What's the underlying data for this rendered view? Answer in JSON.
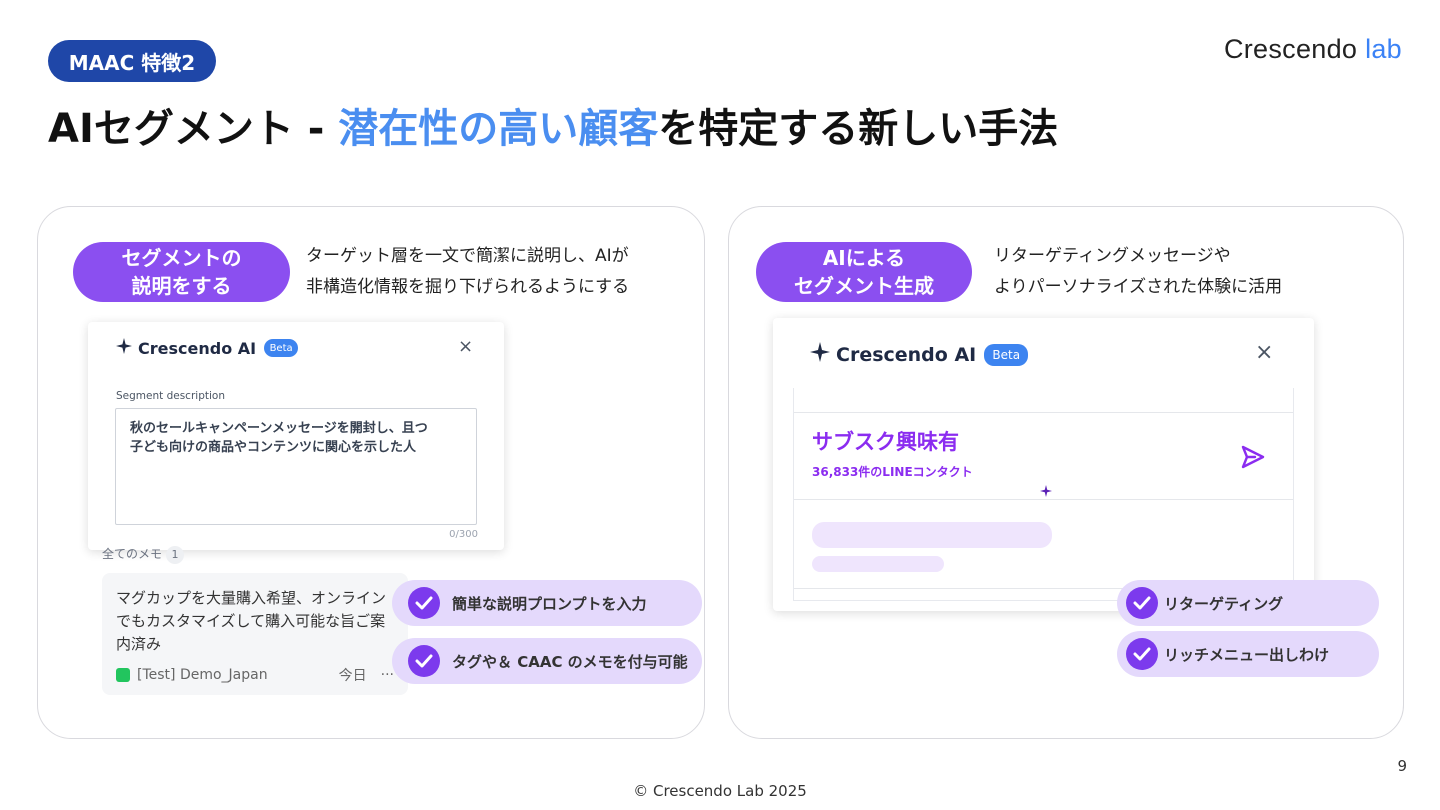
{
  "header": {
    "badge": "MAAC 特徴2",
    "logo_main": "Crescendo",
    "logo_accent": "lab",
    "title_pre": "AIセグメント - ",
    "title_highlight": "潜在性の高い顧客",
    "title_post": "を特定する新しい手法"
  },
  "left_panel": {
    "pill": "セグメントの\n説明をする",
    "description": "ターゲット層を一文で簡潔に説明し、AIが\n非構造化情報を掘り下げられるようにする",
    "card": {
      "ai_name": "Crescendo AI",
      "beta": "Beta",
      "close": "×",
      "field_label": "Segment description",
      "field_value": "秋のセールキャンペーンメッセージを開封し、且つ\n子ども向けの商品やコンテンツに関心を示した人",
      "counter": "0/300"
    },
    "memo": {
      "header": "全てのメモ",
      "count": "1",
      "text": "マグカップを大量購入希望、オンライン\nでもカスタマイズして購入可能な旨ご案\n内済み",
      "account": "[Test] Demo_Japan",
      "date": "今日",
      "more": "···"
    },
    "checks": [
      "簡単な説明プロンプトを入力",
      "タグや＆ CAAC のメモを付与可能"
    ]
  },
  "right_panel": {
    "pill": "AIによる\nセグメント生成",
    "description": "リターゲティングメッセージや\nよりパーソナライズされた体験に活用",
    "card": {
      "ai_name": "Crescendo AI",
      "beta": "Beta",
      "close": "×",
      "result_title": "サブスク興味有",
      "result_sub": "36,833件のLINEコンタクト"
    },
    "checks": [
      "リターゲティング",
      "リッチメニュー出しわけ"
    ]
  },
  "footer": {
    "page": "9",
    "copyright": "© Crescendo Lab 2025"
  },
  "colors": {
    "brand_blue": "#1f47a8",
    "highlight_blue": "#4a8ef0",
    "purple": "#8b4ff0",
    "check_bg": "#e4d9fc"
  }
}
